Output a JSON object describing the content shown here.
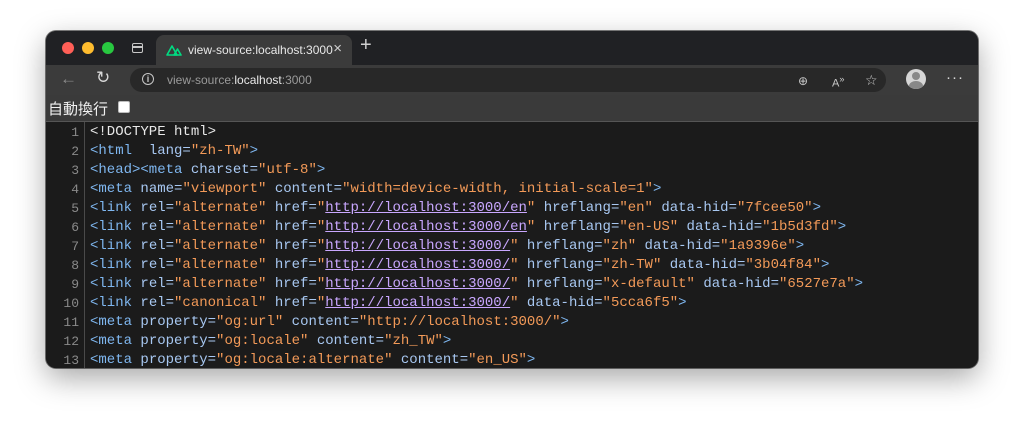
{
  "tab": {
    "title": "view-source:localhost:3000"
  },
  "toolbar": {
    "url_prefix": "view-source:",
    "url_host": "localhost",
    "url_port": ":3000"
  },
  "wrap": {
    "label": "自動換行",
    "checked": false
  },
  "colors": {
    "tag": "#7fb7f0",
    "attribute": "#a8c8f2",
    "value": "#f39a58",
    "link": "#c9a7ff"
  },
  "lines": [
    {
      "n": "1",
      "tokens": [
        [
          "plain",
          "<!DOCTYPE html>"
        ]
      ]
    },
    {
      "n": "2",
      "tokens": [
        [
          "tag",
          "<html "
        ],
        [
          "attr",
          " lang="
        ],
        [
          "val",
          "\"zh-TW\""
        ],
        [
          "tag",
          ">"
        ]
      ]
    },
    {
      "n": "3",
      "tokens": [
        [
          "tag",
          "<head><meta "
        ],
        [
          "attr",
          "charset="
        ],
        [
          "val",
          "\"utf-8\""
        ],
        [
          "tag",
          ">"
        ]
      ]
    },
    {
      "n": "4",
      "tokens": [
        [
          "tag",
          "<meta "
        ],
        [
          "attr",
          "name="
        ],
        [
          "val",
          "\"viewport\""
        ],
        [
          "attr",
          " content="
        ],
        [
          "val",
          "\"width=device-width, initial-scale=1\""
        ],
        [
          "tag",
          ">"
        ]
      ]
    },
    {
      "n": "5",
      "tokens": [
        [
          "tag",
          "<link "
        ],
        [
          "attr",
          "rel="
        ],
        [
          "val",
          "\"alternate\""
        ],
        [
          "attr",
          " href="
        ],
        [
          "val",
          "\""
        ],
        [
          "link",
          "http://localhost:3000/en"
        ],
        [
          "val",
          "\""
        ],
        [
          "attr",
          " hreflang="
        ],
        [
          "val",
          "\"en\""
        ],
        [
          "attr",
          " data-hid="
        ],
        [
          "val",
          "\"7fcee50\""
        ],
        [
          "tag",
          ">"
        ]
      ]
    },
    {
      "n": "6",
      "tokens": [
        [
          "tag",
          "<link "
        ],
        [
          "attr",
          "rel="
        ],
        [
          "val",
          "\"alternate\""
        ],
        [
          "attr",
          " href="
        ],
        [
          "val",
          "\""
        ],
        [
          "link",
          "http://localhost:3000/en"
        ],
        [
          "val",
          "\""
        ],
        [
          "attr",
          " hreflang="
        ],
        [
          "val",
          "\"en-US\""
        ],
        [
          "attr",
          " data-hid="
        ],
        [
          "val",
          "\"1b5d3fd\""
        ],
        [
          "tag",
          ">"
        ]
      ]
    },
    {
      "n": "7",
      "tokens": [
        [
          "tag",
          "<link "
        ],
        [
          "attr",
          "rel="
        ],
        [
          "val",
          "\"alternate\""
        ],
        [
          "attr",
          " href="
        ],
        [
          "val",
          "\""
        ],
        [
          "link",
          "http://localhost:3000/"
        ],
        [
          "val",
          "\""
        ],
        [
          "attr",
          " hreflang="
        ],
        [
          "val",
          "\"zh\""
        ],
        [
          "attr",
          " data-hid="
        ],
        [
          "val",
          "\"1a9396e\""
        ],
        [
          "tag",
          ">"
        ]
      ]
    },
    {
      "n": "8",
      "tokens": [
        [
          "tag",
          "<link "
        ],
        [
          "attr",
          "rel="
        ],
        [
          "val",
          "\"alternate\""
        ],
        [
          "attr",
          " href="
        ],
        [
          "val",
          "\""
        ],
        [
          "link",
          "http://localhost:3000/"
        ],
        [
          "val",
          "\""
        ],
        [
          "attr",
          " hreflang="
        ],
        [
          "val",
          "\"zh-TW\""
        ],
        [
          "attr",
          " data-hid="
        ],
        [
          "val",
          "\"3b04f84\""
        ],
        [
          "tag",
          ">"
        ]
      ]
    },
    {
      "n": "9",
      "tokens": [
        [
          "tag",
          "<link "
        ],
        [
          "attr",
          "rel="
        ],
        [
          "val",
          "\"alternate\""
        ],
        [
          "attr",
          " href="
        ],
        [
          "val",
          "\""
        ],
        [
          "link",
          "http://localhost:3000/"
        ],
        [
          "val",
          "\""
        ],
        [
          "attr",
          " hreflang="
        ],
        [
          "val",
          "\"x-default\""
        ],
        [
          "attr",
          " data-hid="
        ],
        [
          "val",
          "\"6527e7a\""
        ],
        [
          "tag",
          ">"
        ]
      ]
    },
    {
      "n": "10",
      "tokens": [
        [
          "tag",
          "<link "
        ],
        [
          "attr",
          "rel="
        ],
        [
          "val",
          "\"canonical\""
        ],
        [
          "attr",
          " href="
        ],
        [
          "val",
          "\""
        ],
        [
          "link",
          "http://localhost:3000/"
        ],
        [
          "val",
          "\""
        ],
        [
          "attr",
          " data-hid="
        ],
        [
          "val",
          "\"5cca6f5\""
        ],
        [
          "tag",
          ">"
        ]
      ]
    },
    {
      "n": "11",
      "tokens": [
        [
          "tag",
          "<meta "
        ],
        [
          "attr",
          "property="
        ],
        [
          "val",
          "\"og:url\""
        ],
        [
          "attr",
          " content="
        ],
        [
          "val",
          "\"http://localhost:3000/\""
        ],
        [
          "tag",
          ">"
        ]
      ]
    },
    {
      "n": "12",
      "tokens": [
        [
          "tag",
          "<meta "
        ],
        [
          "attr",
          "property="
        ],
        [
          "val",
          "\"og:locale\""
        ],
        [
          "attr",
          " content="
        ],
        [
          "val",
          "\"zh_TW\""
        ],
        [
          "tag",
          ">"
        ]
      ]
    },
    {
      "n": "13",
      "tokens": [
        [
          "tag",
          "<meta "
        ],
        [
          "attr",
          "property="
        ],
        [
          "val",
          "\"og:locale:alternate\""
        ],
        [
          "attr",
          " content="
        ],
        [
          "val",
          "\"en_US\""
        ],
        [
          "tag",
          ">"
        ]
      ]
    }
  ]
}
